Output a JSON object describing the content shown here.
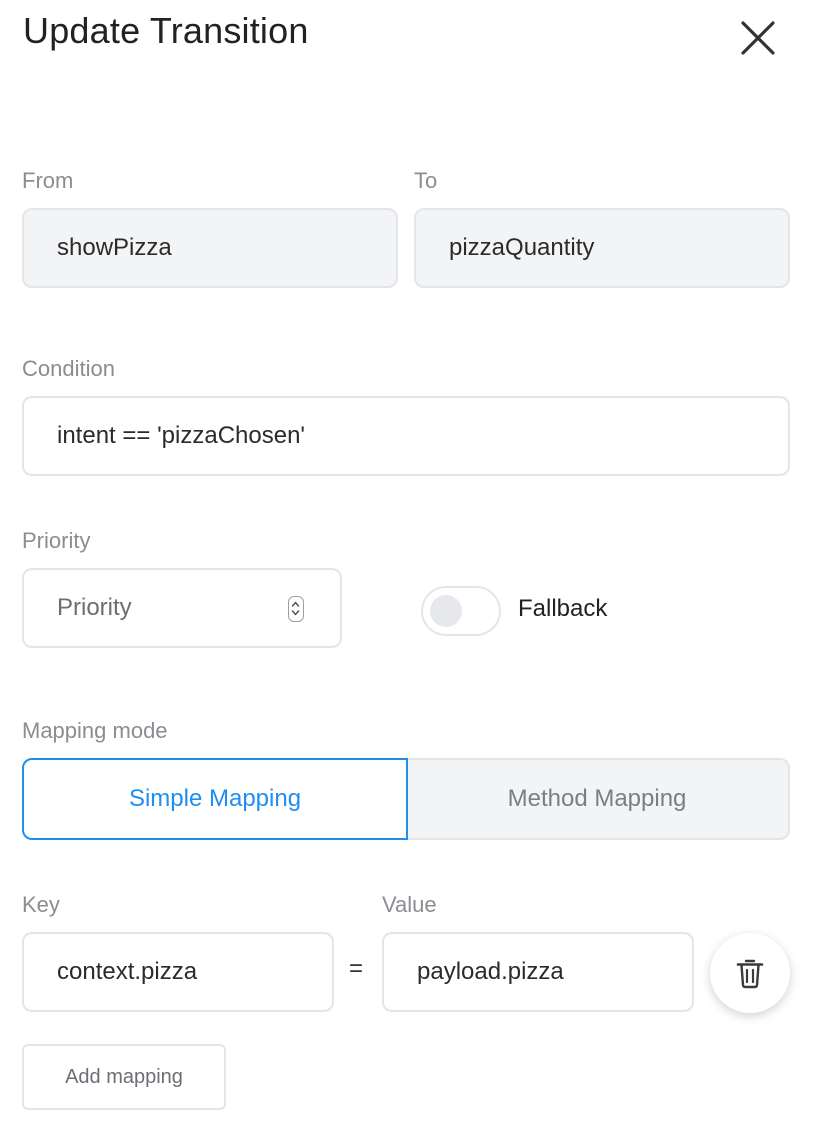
{
  "dialog": {
    "title": "Update Transition",
    "close_icon": "close-icon"
  },
  "from": {
    "label": "From",
    "value": "showPizza"
  },
  "to": {
    "label": "To",
    "value": "pizzaQuantity"
  },
  "condition": {
    "label": "Condition",
    "value": "intent == 'pizzaChosen'"
  },
  "priority": {
    "label": "Priority",
    "placeholder": "Priority",
    "spinner_icon": "stepper-icon"
  },
  "fallback": {
    "label": "Fallback",
    "enabled": false
  },
  "mapping_mode": {
    "label": "Mapping mode",
    "options": [
      "Simple Mapping",
      "Method Mapping"
    ],
    "selected": "Simple Mapping"
  },
  "mappings": {
    "key_label": "Key",
    "value_label": "Value",
    "separator": "=",
    "rows": [
      {
        "key": "context.pizza",
        "value": "payload.pizza",
        "delete_icon": "trash-icon"
      }
    ],
    "add_label": "Add mapping"
  },
  "colors": {
    "accent": "#1f8ef1",
    "label": "#8a8d92",
    "field_border": "#e3e5e8",
    "readonly_bg": "#f3f4f6"
  }
}
